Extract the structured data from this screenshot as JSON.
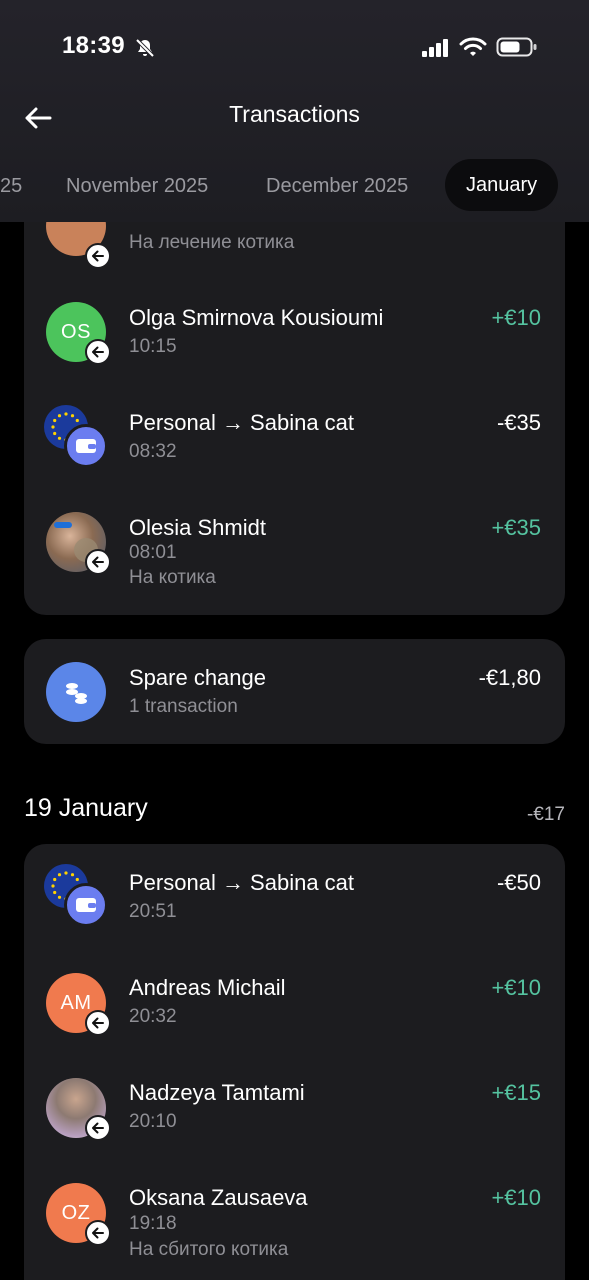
{
  "status": {
    "time": "18:39"
  },
  "header": {
    "title": "Transactions"
  },
  "tabs": [
    {
      "label": "25"
    },
    {
      "label": "November 2025"
    },
    {
      "label": "December 2025"
    },
    {
      "label": "January"
    }
  ],
  "card1": {
    "partial_row": {
      "note": "На лечение котика"
    },
    "rows": [
      {
        "initials": "OS",
        "name": "Olga Smirnova Kousioumi",
        "time": "10:15",
        "amount": "+€10"
      },
      {
        "name": "Personal → Sabina cat",
        "time": "08:32",
        "amount": "-€35"
      },
      {
        "name": "Olesia Shmidt",
        "time": "08:01",
        "note": "На котика",
        "amount": "+€35"
      }
    ]
  },
  "spare_change": {
    "name": "Spare change",
    "sub": "1 transaction",
    "amount": "-€1,80"
  },
  "section": {
    "date": "19 January",
    "total": "-€17"
  },
  "card2": {
    "rows": [
      {
        "name": "Personal → Sabina cat",
        "time": "20:51",
        "amount": "-€50"
      },
      {
        "initials": "AM",
        "name": "Andreas Michail",
        "time": "20:32",
        "amount": "+€10"
      },
      {
        "name": "Nadzeya Tamtami",
        "time": "20:10",
        "amount": "+€15"
      },
      {
        "initials": "OZ",
        "name": "Oksana Zausaeva",
        "time": "19:18",
        "note": "На сбитого котика",
        "amount": "+€10"
      }
    ]
  },
  "colors": {
    "positive": "#55c3a0",
    "card": "#1c1c1f",
    "green_avatar": "#4cc45c",
    "orange_avatar": "#f07a4e",
    "wallet": "#6b7df0",
    "spare_icon": "#5b86e8"
  }
}
